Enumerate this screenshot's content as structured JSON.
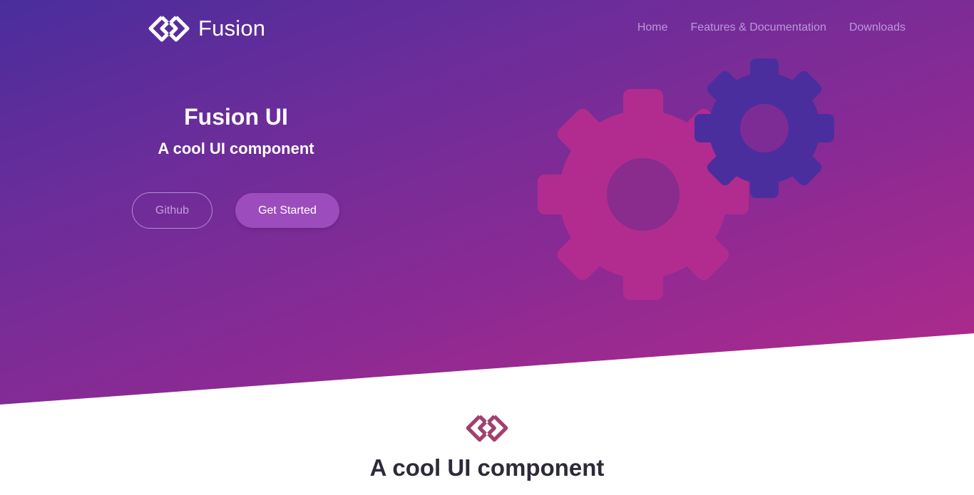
{
  "brand": {
    "name": "Fusion",
    "logo_icon": "linked-rings-icon"
  },
  "nav": {
    "items": [
      {
        "label": "Home"
      },
      {
        "label": "Features & Documentation"
      },
      {
        "label": "Downloads"
      }
    ]
  },
  "hero": {
    "title": "Fusion UI",
    "subtitle": "A cool UI component",
    "github_label": "Github",
    "get_started_label": "Get Started",
    "illustration": "gears-icon"
  },
  "feature": {
    "icon": "linked-rings-icon",
    "title": "A cool UI component"
  },
  "colors": {
    "gradient_start": "#4a2d9c",
    "gradient_end": "#b52a8a",
    "gear_large": "#b22c8f",
    "gear_small": "#4a2e9e",
    "button_primary": "#9c4cbc",
    "feature_icon": "#a0406e",
    "feature_title": "#2e2a3a"
  }
}
